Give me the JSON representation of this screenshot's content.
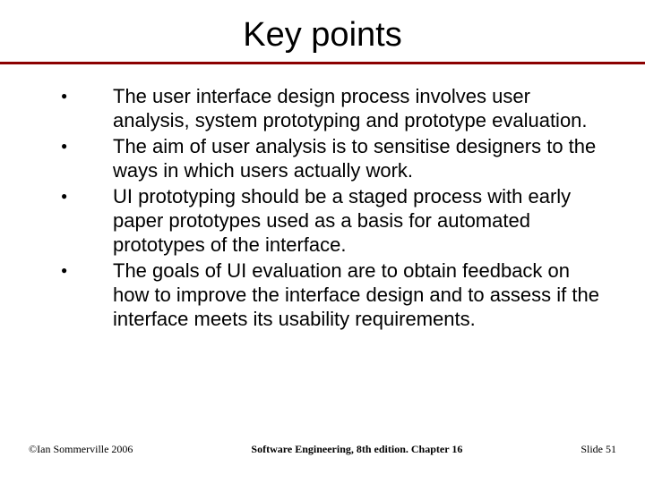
{
  "title": "Key points",
  "bullets": [
    "The user interface design process involves user analysis, system prototyping and prototype evaluation.",
    "The aim of user analysis is to sensitise designers to the ways in which users actually work.",
    "UI prototyping should be a staged process with early paper prototypes used as a basis for automated prototypes of the interface.",
    "The goals of UI evaluation are to obtain feedback on how to improve the interface design and to assess if the interface meets its usability requirements."
  ],
  "footer": {
    "left": "©Ian Sommerville 2006",
    "center": "Software Engineering, 8th edition. Chapter 16",
    "right": "Slide 51"
  }
}
